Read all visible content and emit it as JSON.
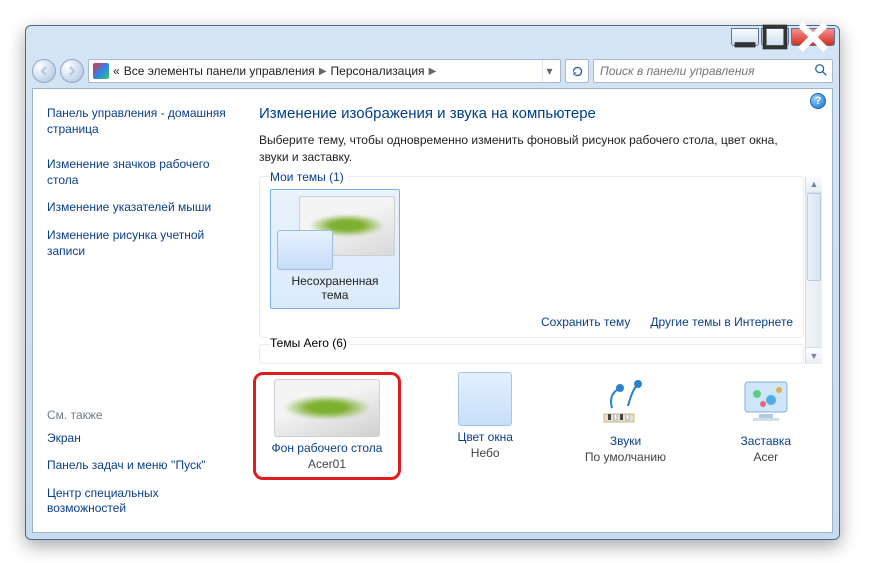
{
  "breadcrumb": {
    "prefix": "«",
    "panel_all": "Все элементы панели управления",
    "current": "Персонализация"
  },
  "search": {
    "placeholder": "Поиск в панели управления"
  },
  "left": {
    "home": "Панель управления - домашняя страница",
    "icons": "Изменение значков рабочего стола",
    "pointers": "Изменение указателей мыши",
    "account_pic": "Изменение рисунка учетной записи",
    "see_also": "См. также",
    "display": "Экран",
    "taskbar": "Панель задач и меню ''Пуск''",
    "ease": "Центр специальных возможностей"
  },
  "main": {
    "title": "Изменение изображения и звука на компьютере",
    "desc": "Выберите тему, чтобы одновременно изменить фоновый рисунок рабочего стола, цвет окна, звуки и заставку.",
    "my_themes": "Мои темы (1)",
    "theme_name": "Несохраненная тема",
    "save_theme": "Сохранить тему",
    "more_online": "Другие темы в Интернете",
    "aero_themes": "Темы Aero (6)"
  },
  "bottom": {
    "wallpaper_label": "Фон рабочего стола",
    "wallpaper_value": "Acer01",
    "color_label": "Цвет окна",
    "color_value": "Небо",
    "sounds_label": "Звуки",
    "sounds_value": "По умолчанию",
    "saver_label": "Заставка",
    "saver_value": "Acer"
  }
}
